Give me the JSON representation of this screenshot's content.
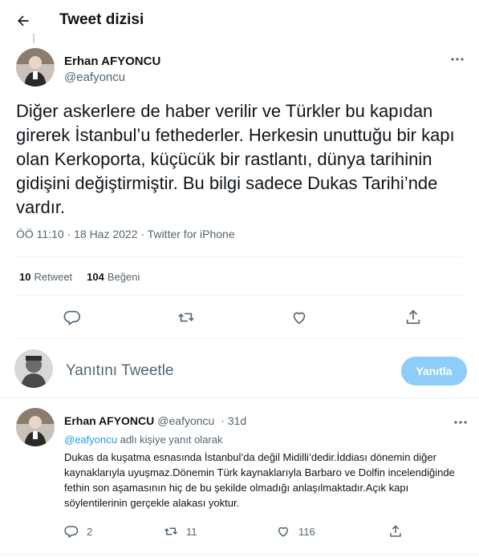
{
  "header": {
    "title": "Tweet dizisi",
    "back_icon": "arrow-left-icon"
  },
  "main_tweet": {
    "author_name": "Erhan AFYONCU",
    "author_handle": "@eafyoncu",
    "text": "Diğer askerlere de haber verilir ve Türkler bu kapıdan girerek İstanbul’u fethederler. Herkesin unuttuğu bir kapı olan Kerkoporta, küçücük bir rastlantı, dünya tarihinin gidişini değiştirmiştir. Bu bilgi sadece Dukas Tarihi’nde vardır.",
    "meta": "ÖÖ 11:10 · 18 Haz 2022 · Twitter for iPhone",
    "retweets_count": "10",
    "retweets_label": "Retweet",
    "likes_count": "104",
    "likes_label": "Beğeni",
    "action_icons": [
      "reply-icon",
      "retweet-icon",
      "like-icon",
      "share-icon"
    ]
  },
  "reply_box": {
    "placeholder": "Yanıtını Tweetle",
    "button_label": "Yanıtla",
    "button_color": "#8ecdf7"
  },
  "reply_tweet": {
    "author_name": "Erhan AFYONCU",
    "author_handle": "@eafyoncu",
    "time": "· 31d",
    "replying_mention": "@eafyoncu",
    "replying_suffix": "adlı kişiye yanıt olarak",
    "text": "Dukas da kuşatma esnasında İstanbul’da değil Midilli’dedir.İddiası dönemin diğer kaynaklarıyla uyuşmaz.Dönemin Türk kaynaklarıyla Barbaro ve Dolfin incelendiğinde fethin son aşamasının hiç de bu şekilde olmadığı anlaşılmaktadır.Açık kapı söylentilerinin gerçekle alakası yoktur.",
    "reply_count": "2",
    "retweet_count": "11",
    "like_count": "116"
  },
  "colors": {
    "accent": "#1d9bf0",
    "secondary_text": "#536471",
    "divider": "#eff3f4"
  }
}
